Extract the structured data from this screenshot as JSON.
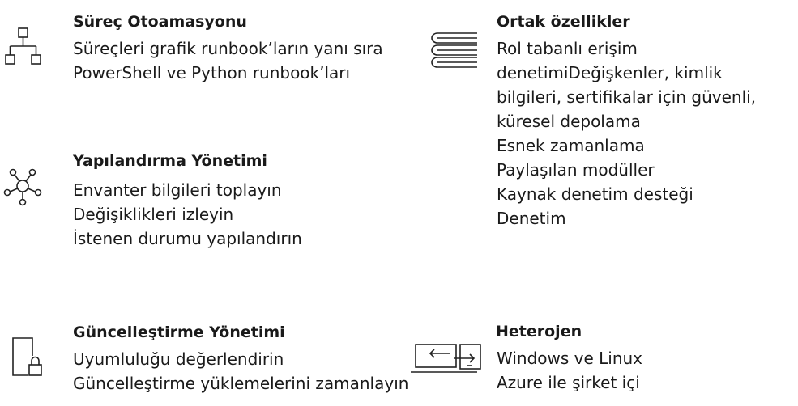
{
  "features": {
    "process_automation": {
      "title": "Süreç Otoamasyonu",
      "icon": "hierarchy-icon",
      "lines": [
        "Süreçleri grafik runbook’ların yanı sıra",
        "PowerShell ve Python runbook’ları"
      ]
    },
    "common_features": {
      "title": "Ortak özellikler",
      "icon": "books-icon",
      "lines": [
        "Rol tabanlı erişim",
        "denetimiDeğişkenler, kimlik",
        "bilgileri, sertifikalar için güvenli,",
        "küresel depolama",
        "Esnek zamanlama",
        "Paylaşılan modüller",
        "Kaynak denetim desteği",
        "Denetim"
      ]
    },
    "configuration_management": {
      "title": "Yapılandırma Yönetimi",
      "icon": "network-hub-icon",
      "lines": [
        "Envanter bilgileri toplayın",
        "Değişiklikleri izleyin",
        "İstenen durumu yapılandırın"
      ]
    },
    "update_management": {
      "title": "Güncelleştirme Yönetimi",
      "icon": "device-lock-icon",
      "lines": [
        "Uyumluluğu değerlendirin",
        "Güncelleştirme yüklemelerini zamanlayın"
      ]
    },
    "heterogeneous": {
      "title": "Heterojen",
      "icon": "laptop-exchange-icon",
      "lines": [
        "Windows ve Linux",
        "Azure ile şirket içi"
      ]
    }
  }
}
